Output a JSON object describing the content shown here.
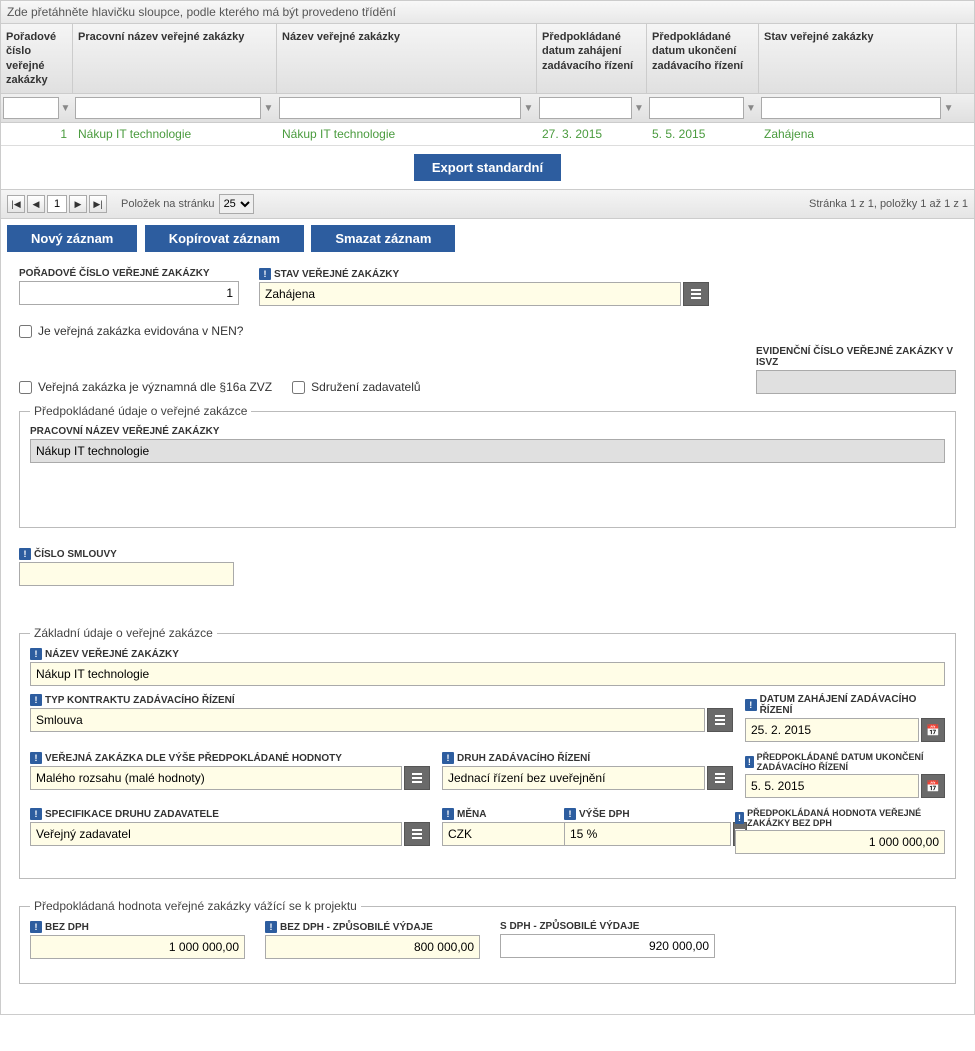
{
  "grid": {
    "group_hint": "Zde přetáhněte hlavičku sloupce, podle kterého má být provedeno třídění",
    "cols": {
      "c1": "Pořadové číslo veřejné zakázky",
      "c2": "Pracovní název veřejné zakázky",
      "c3": "Název veřejné zakázky",
      "c4": "Předpokládané datum zahájení zadávacího řízení",
      "c5": "Předpokládané datum ukončení zadávacího řízení",
      "c6": "Stav veřejné zakázky"
    },
    "row": {
      "c1": "1",
      "c2": "Nákup IT technologie",
      "c3": "Nákup IT technologie",
      "c4": "27. 3. 2015",
      "c5": "5. 5. 2015",
      "c6": "Zahájena"
    },
    "export_btn": "Export standardní"
  },
  "pager": {
    "page": "1",
    "per_page_label": "Položek na stránku",
    "per_page_value": "25",
    "summary": "Stránka 1 z 1, položky 1 až 1 z 1"
  },
  "actions": {
    "new": "Nový záznam",
    "copy": "Kopírovat záznam",
    "delete": "Smazat záznam"
  },
  "form": {
    "poradove_label": "POŘADOVÉ ČÍSLO VEŘEJNÉ ZAKÁZKY",
    "poradove_value": "1",
    "stav_label": "STAV VEŘEJNÉ ZAKÁZKY",
    "stav_value": "Zahájena",
    "nen_cb_label": "Je veřejná zakázka evidována v NEN?",
    "vyznamna_cb_label": "Veřejná zakázka je významná dle §16a ZVZ",
    "sdruzeni_cb_label": "Sdružení zadavatelů",
    "evid_isvz_label": "EVIDENČNÍ ČÍSLO VEŘEJNÉ ZAKÁZKY V ISVZ",
    "evid_isvz_value": "",
    "fs1_legend": "Předpokládané údaje o veřejné zakázce",
    "prac_nazev_label": "PRACOVNÍ NÁZEV VEŘEJNÉ ZAKÁZKY",
    "prac_nazev_value": "Nákup IT technologie",
    "cislo_smlouvy_label": "ČÍSLO SMLOUVY",
    "cislo_smlouvy_value": "",
    "fs2_legend": "Základní údaje o veřejné zakázce",
    "nazev_vz_label": "NÁZEV VEŘEJNÉ ZAKÁZKY",
    "nazev_vz_value": "Nákup IT technologie",
    "typ_kontraktu_label": "TYP KONTRAKTU ZADÁVACÍHO ŘÍZENÍ",
    "typ_kontraktu_value": "Smlouva",
    "datum_zahajeni_label": "DATUM ZAHÁJENÍ ZADÁVACÍHO ŘÍZENÍ",
    "datum_zahajeni_value": "25. 2. 2015",
    "vz_hodnota_label": "VEŘEJNÁ ZAKÁZKA DLE VÝŠE PŘEDPOKLÁDANÉ HODNOTY",
    "vz_hodnota_value": "Malého rozsahu (malé hodnoty)",
    "druh_rizeni_label": "DRUH ZADÁVACÍHO ŘÍZENÍ",
    "druh_rizeni_value": "Jednací řízení bez uveřejnění",
    "datum_ukonceni_label": "PŘEDPOKLÁDANÉ DATUM UKONČENÍ ZADÁVACÍHO ŘÍZENÍ",
    "datum_ukonceni_value": "5. 5. 2015",
    "spec_zadavatele_label": "SPECIFIKACE DRUHU ZADAVATELE",
    "spec_zadavatele_value": "Veřejný zadavatel",
    "mena_label": "MĚNA",
    "mena_value": "CZK",
    "vyse_dph_label": "VÝŠE DPH",
    "vyse_dph_value": "15 %",
    "predp_hodnota_label": "PŘEDPOKLÁDANÁ HODNOTA VEŘEJNÉ ZAKÁZKY BEZ DPH",
    "predp_hodnota_value": "1 000 000,00",
    "fs3_legend": "Předpokládaná hodnota veřejné zakázky vážící se k projektu",
    "bez_dph_label": "BEZ DPH",
    "bez_dph_value": "1 000 000,00",
    "bez_dph_zv_label": "BEZ DPH - ZPŮSOBILÉ VÝDAJE",
    "bez_dph_zv_value": "800 000,00",
    "s_dph_zv_label": "S DPH - ZPŮSOBILÉ VÝDAJE",
    "s_dph_zv_value": "920 000,00"
  }
}
